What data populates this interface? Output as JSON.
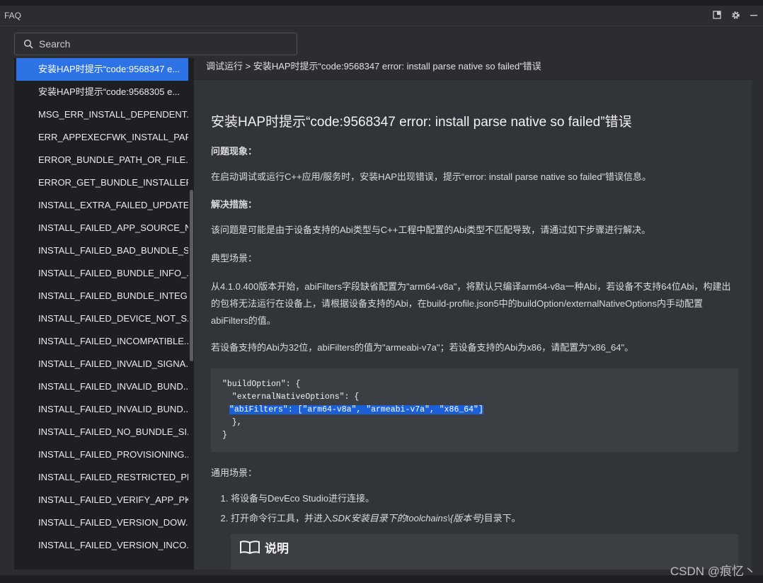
{
  "window": {
    "title": "FAQ"
  },
  "search": {
    "placeholder": "Search"
  },
  "sidebar": {
    "items": [
      {
        "label": "安装HAP时提示“code:9568347 e..."
      },
      {
        "label": "安装HAP时提示“code:9568305 e..."
      },
      {
        "label": "MSG_ERR_INSTALL_DEPENDENT..."
      },
      {
        "label": "ERR_APPEXECFWK_INSTALL_PAR..."
      },
      {
        "label": "ERROR_BUNDLE_PATH_OR_FILE..."
      },
      {
        "label": "ERROR_GET_BUNDLE_INSTALLER..."
      },
      {
        "label": "INSTALL_EXTRA_FAILED_UPDATE..."
      },
      {
        "label": "INSTALL_FAILED_APP_SOURCE_N..."
      },
      {
        "label": "INSTALL_FAILED_BAD_BUNDLE_S..."
      },
      {
        "label": "INSTALL_FAILED_BUNDLE_INFO_..."
      },
      {
        "label": "INSTALL_FAILED_BUNDLE_INTEG..."
      },
      {
        "label": "INSTALL_FAILED_DEVICE_NOT_S..."
      },
      {
        "label": "INSTALL_FAILED_INCOMPATIBLE..."
      },
      {
        "label": "INSTALL_FAILED_INVALID_SIGNA..."
      },
      {
        "label": "INSTALL_FAILED_INVALID_BUND..."
      },
      {
        "label": "INSTALL_FAILED_INVALID_BUND..."
      },
      {
        "label": "INSTALL_FAILED_NO_BUNDLE_SI..."
      },
      {
        "label": "INSTALL_FAILED_PROVISIONING..."
      },
      {
        "label": "INSTALL_FAILED_RESTRICTED_PE..."
      },
      {
        "label": "INSTALL_FAILED_VERIFY_APP_PK..."
      },
      {
        "label": "INSTALL_FAILED_VERSION_DOW..."
      },
      {
        "label": "INSTALL_FAILED_VERSION_INCO..."
      }
    ]
  },
  "article": {
    "breadcrumb": "调试运行 > 安装HAP时提示“code:9568347 error: install parse native so failed”错误",
    "title": "安装HAP时提示“code:9568347 error: install parse native so failed”错误",
    "problem_label": "问题现象：",
    "problem_text": "在启动调试或运行C++应用/服务时，安装HAP出现错误，提示“error: install parse native so failed”错误信息。",
    "solution_label": "解决措施：",
    "solution_text": "该问题是可能是由于设备支持的Abi类型与C++工程中配置的Abi类型不匹配导致，请通过如下步骤进行解决。",
    "typical_label": "典型场景：",
    "typical_text": "从4.1.0.400版本开始，abiFilters字段缺省配置为\"arm64-v8a\"，将默认只编译arm64-v8a一种Abi，若设备不支持64位Abi，构建出的包将无法运行在设备上，请根据设备支持的Abi，在build-profile.json5中的buildOption/externalNativeOptions内手动配置abiFilters的值。",
    "abi_text": "若设备支持的Abi为32位，abiFilters的值为\"armeabi-v7a\"；若设备支持的Abi为x86，请配置为\"x86_64\"。",
    "code_lines": [
      "\"buildOption\": {",
      "  \"externalNativeOptions\": {",
      "\"abiFilters\": [\"arm64-v8a\", \"armeabi-v7a\", \"x86_64\"]",
      "  },",
      "}"
    ],
    "general_label": "通用场景：",
    "steps": [
      "将设备与DevEco Studio进行连接。",
      "打开命令行工具，并进入",
      "SDK安装目录下的toolchains\\{版本号}",
      "目录下。"
    ],
    "note_label": "说明"
  },
  "watermark": "CSDN @痕忆丶",
  "colors": {
    "accent": "#2e73e6",
    "highlight": "#1a5fd6"
  },
  "icons": [
    "search-icon",
    "restore-window-icon",
    "gear-icon",
    "minimize-icon",
    "book-icon"
  ]
}
